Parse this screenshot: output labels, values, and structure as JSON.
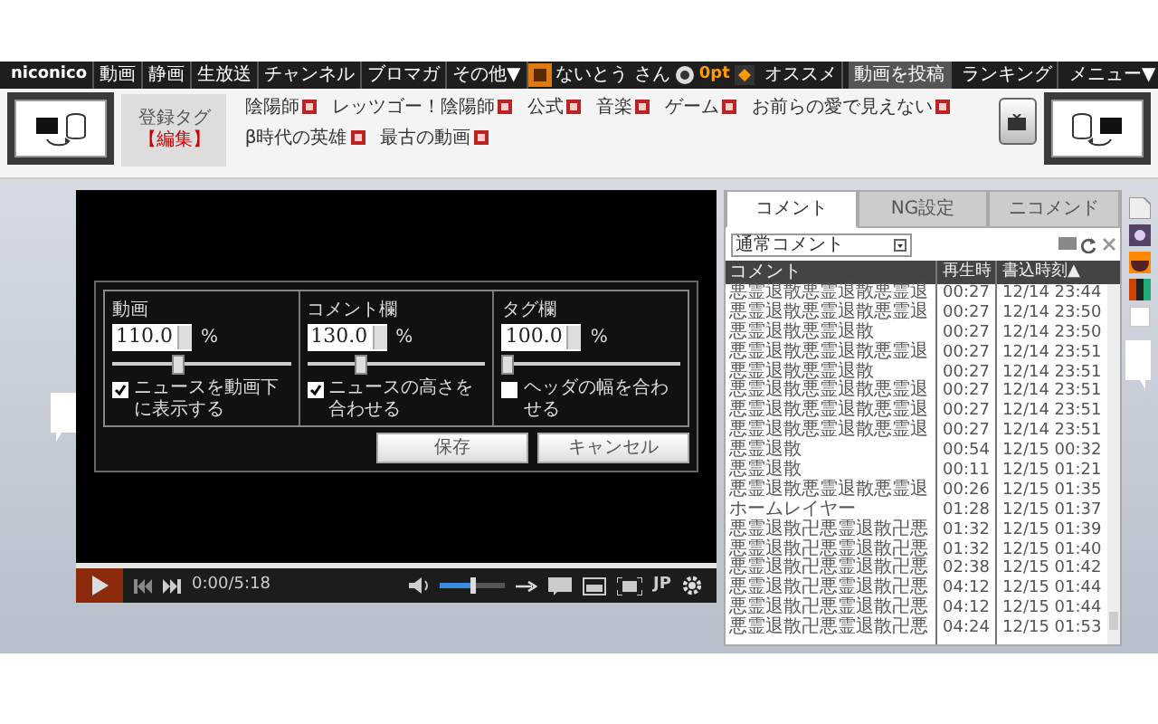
{
  "nav": {
    "brand": "niconico",
    "links": [
      "動画",
      "静画",
      "生放送",
      "チャンネル",
      "ブロマガ",
      "その他▼"
    ],
    "user": "ないとう さん",
    "points": "0pt",
    "right_links": [
      {
        "label": "オススメ",
        "selected": false
      },
      {
        "label": "動画を投稿",
        "selected": true
      },
      {
        "label": "ランキング",
        "selected": false
      },
      {
        "label": "メニュー▼",
        "selected": false
      }
    ]
  },
  "tags": {
    "label": "登録タグ",
    "edit": "【編集】",
    "items": [
      "陰陽師",
      "レッツゴー！陰陽師",
      "公式",
      "音楽",
      "ゲーム",
      "お前らの愛で見えない",
      "β時代の英雄",
      "最古の動画"
    ]
  },
  "player": {
    "time": "0:00/5:18",
    "volume": {
      "level": 0.5
    },
    "language": "JP"
  },
  "settings_dialog": {
    "columns": [
      {
        "title": "動画",
        "value": "110.0",
        "unit": "%",
        "slider": {
          "level": 0.36
        },
        "option": {
          "label": "ニュースを動画下に表示する",
          "checked": true
        }
      },
      {
        "title": "コメント欄",
        "value": "130.0",
        "unit": "%",
        "slider": {
          "level": 0.3
        },
        "option": {
          "label": "ニュースの高さを合わせる",
          "checked": true
        }
      },
      {
        "title": "タグ欄",
        "value": "100.0",
        "unit": "%",
        "slider": {
          "level": 0.03
        },
        "option": {
          "label": "ヘッダの幅を合わせる",
          "checked": false
        }
      }
    ],
    "buttons": [
      "保存",
      "キャンセル"
    ]
  },
  "comment_panel": {
    "tabs": [
      {
        "label": "コメント",
        "selected": true
      },
      {
        "label": "NG設定",
        "selected": false
      },
      {
        "label": "ニコメンド",
        "selected": false
      }
    ],
    "filter": "通常コメント",
    "columns": [
      "コメント",
      "再生時",
      "書込時刻▲"
    ],
    "rows": [
      {
        "comment": "悪霊退散悪霊退散悪霊退",
        "time": "00:27",
        "posted": "12/14 23:44"
      },
      {
        "comment": "悪霊退散悪霊退散悪霊退",
        "time": "00:27",
        "posted": "12/14 23:50"
      },
      {
        "comment": "悪霊退散悪霊退散",
        "time": "00:27",
        "posted": "12/14 23:50"
      },
      {
        "comment": "悪霊退散悪霊退散悪霊退",
        "time": "00:27",
        "posted": "12/14 23:51"
      },
      {
        "comment": "悪霊退散悪霊退散",
        "time": "00:27",
        "posted": "12/14 23:51"
      },
      {
        "comment": "悪霊退散悪霊退散悪霊退",
        "time": "00:27",
        "posted": "12/14 23:51"
      },
      {
        "comment": "悪霊退散悪霊退散悪霊退",
        "time": "00:27",
        "posted": "12/14 23:51"
      },
      {
        "comment": "悪霊退散悪霊退散悪霊退",
        "time": "00:27",
        "posted": "12/14 23:51"
      },
      {
        "comment": "悪霊退散",
        "time": "00:54",
        "posted": "12/15 00:32"
      },
      {
        "comment": "悪霊退散",
        "time": "00:11",
        "posted": "12/15 01:21"
      },
      {
        "comment": "悪霊退散悪霊退散悪霊退",
        "time": "00:26",
        "posted": "12/15 01:35"
      },
      {
        "comment": "ホームレイヤー",
        "time": "01:28",
        "posted": "12/15 01:37"
      },
      {
        "comment": "悪霊退散卍悪霊退散卍悪",
        "time": "01:32",
        "posted": "12/15 01:39"
      },
      {
        "comment": "悪霊退散卍悪霊退散卍悪",
        "time": "01:32",
        "posted": "12/15 01:40"
      },
      {
        "comment": "悪霊退散卍悪霊退散卍悪",
        "time": "02:38",
        "posted": "12/15 01:42"
      },
      {
        "comment": "悪霊退散卍悪霊退散卍悪",
        "time": "04:12",
        "posted": "12/15 01:44"
      },
      {
        "comment": "悪霊退散卍悪霊退散卍悪",
        "time": "04:12",
        "posted": "12/15 01:44"
      },
      {
        "comment": "悪霊退散卍悪霊退散卍悪",
        "time": "04:24",
        "posted": "12/15 01:53"
      }
    ]
  }
}
